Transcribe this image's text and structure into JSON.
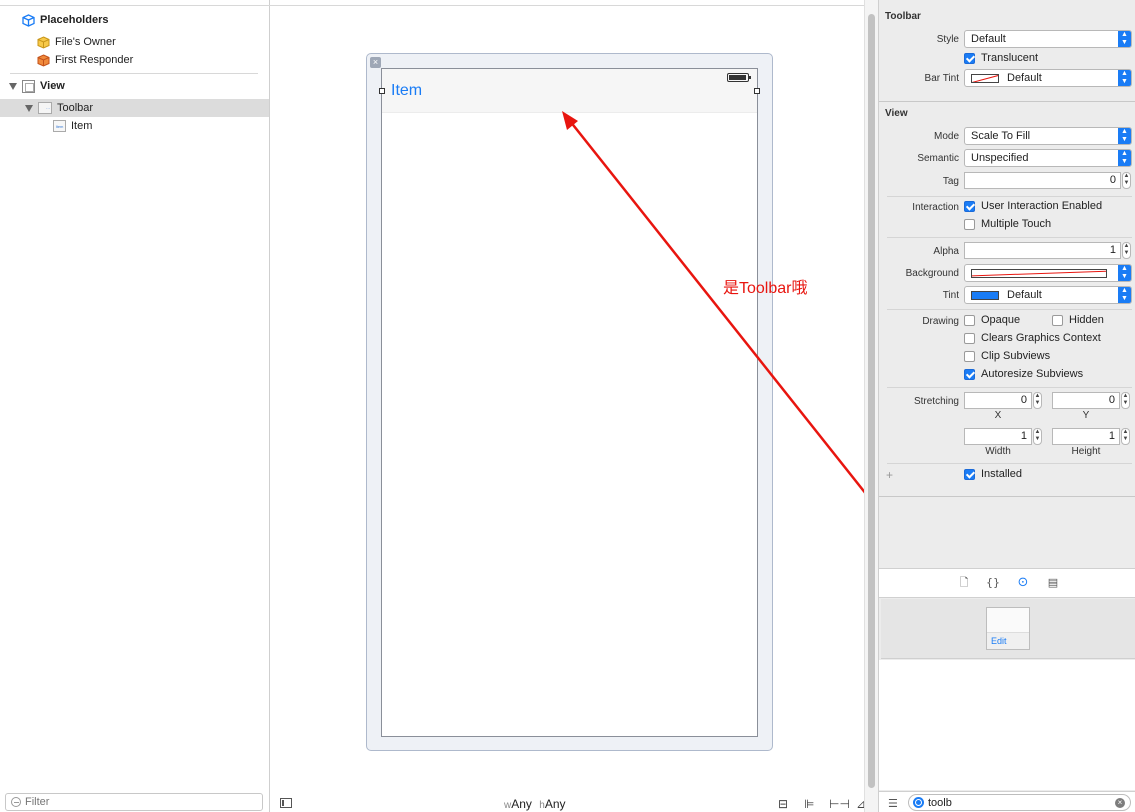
{
  "outline": {
    "placeholders_label": "Placeholders",
    "files_owner_label": "File's Owner",
    "first_responder_label": "First Responder",
    "view_label": "View",
    "toolbar_label": "Toolbar",
    "item_label": "Item",
    "filter_placeholder": "Filter"
  },
  "canvas": {
    "toolbar_item_label": "Item",
    "annotation_text": "是Toolbar哦",
    "size_class_w_prefix": "w",
    "size_class_w_value": "Any",
    "size_class_h_prefix": "h",
    "size_class_h_value": "Any"
  },
  "inspector": {
    "toolbar_section": {
      "title": "Toolbar",
      "style_label": "Style",
      "style_value": "Default",
      "translucent_label": "Translucent",
      "translucent_checked": true,
      "bar_tint_label": "Bar Tint",
      "bar_tint_value": "Default"
    },
    "view_section": {
      "title": "View",
      "mode_label": "Mode",
      "mode_value": "Scale To Fill",
      "semantic_label": "Semantic",
      "semantic_value": "Unspecified",
      "tag_label": "Tag",
      "tag_value": "0",
      "interaction_label": "Interaction",
      "user_interaction_label": "User Interaction Enabled",
      "multiple_touch_label": "Multiple Touch",
      "alpha_label": "Alpha",
      "alpha_value": "1",
      "background_label": "Background",
      "tint_label": "Tint",
      "tint_value": "Default",
      "drawing_label": "Drawing",
      "opaque_label": "Opaque",
      "hidden_label": "Hidden",
      "clears_graphics_label": "Clears Graphics Context",
      "clip_subviews_label": "Clip Subviews",
      "autoresize_label": "Autoresize Subviews",
      "stretching_label": "Stretching",
      "stretch_x_value": "0",
      "stretch_y_value": "0",
      "stretch_width_value": "1",
      "stretch_height_value": "1",
      "x_label": "X",
      "y_label": "Y",
      "width_label": "Width",
      "height_label": "Height",
      "plus_label": "+",
      "installed_label": "Installed"
    },
    "library": {
      "item_edit_label": "Edit",
      "search_value": "toolb"
    }
  },
  "colors": {
    "accent": "#1a7cf5",
    "annotation": "#e8150f"
  }
}
